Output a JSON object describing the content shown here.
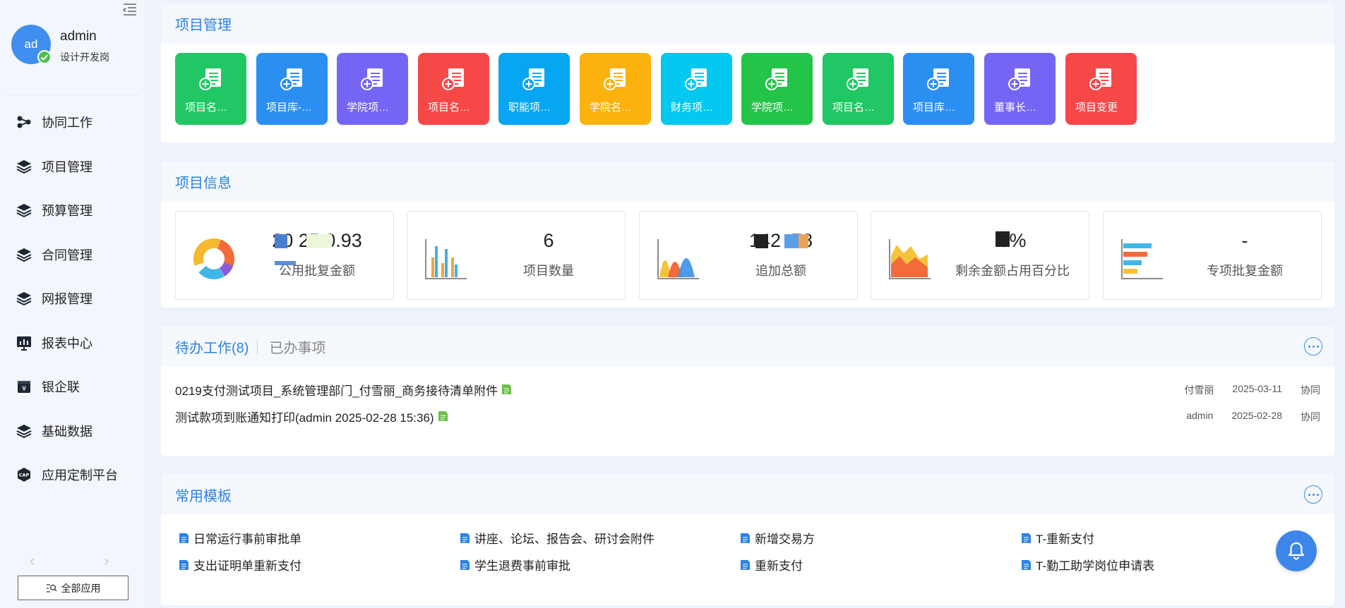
{
  "user": {
    "avatar_text": "ad",
    "name": "admin",
    "role": "设计开发岗"
  },
  "sidebar": {
    "items": [
      {
        "label": "协同工作",
        "icon": "collaboration-icon"
      },
      {
        "label": "项目管理",
        "icon": "layers-icon"
      },
      {
        "label": "预算管理",
        "icon": "layers-icon"
      },
      {
        "label": "合同管理",
        "icon": "layers-icon"
      },
      {
        "label": "网报管理",
        "icon": "layers-icon"
      },
      {
        "label": "报表中心",
        "icon": "report-chart-icon"
      },
      {
        "label": "银企联",
        "icon": "bank-icon"
      },
      {
        "label": "基础数据",
        "icon": "layers-icon"
      },
      {
        "label": "应用定制平台",
        "icon": "cap-icon"
      }
    ],
    "all_apps_label": "全部应用"
  },
  "project_management": {
    "title": "项目管理",
    "tiles": [
      {
        "label": "项目名…",
        "color": "#21c764"
      },
      {
        "label": "项目库-…",
        "color": "#2b8ff2"
      },
      {
        "label": "学院项…",
        "color": "#7565f5"
      },
      {
        "label": "项目名…",
        "color": "#f74848"
      },
      {
        "label": "职能项…",
        "color": "#06a6f2"
      },
      {
        "label": "学院名…",
        "color": "#fbb20e"
      },
      {
        "label": "财务项…",
        "color": "#04c8ef"
      },
      {
        "label": "学院项…",
        "color": "#24c44a"
      },
      {
        "label": "项目名…",
        "color": "#21c764"
      },
      {
        "label": "项目库…",
        "color": "#2b8ff2"
      },
      {
        "label": "董事长…",
        "color": "#7565f5"
      },
      {
        "label": "项目变更",
        "color": "#f74848"
      }
    ]
  },
  "project_info": {
    "title": "项目信息",
    "cards": [
      {
        "value": "20   25    0.93",
        "label": "公用批复金额",
        "chart": "donut-chart-icon"
      },
      {
        "value": "6",
        "label": "项目数量",
        "chart": "bar-chart-icon"
      },
      {
        "value": "142      .78",
        "label": "追加总额",
        "chart": "area-peaks-icon"
      },
      {
        "value": "6%",
        "label": "剩余金额占用百分比",
        "chart": "area-chart-icon"
      },
      {
        "value": "-",
        "label": "专项批复金额",
        "chart": "horizontal-bar-icon"
      }
    ]
  },
  "todo": {
    "tab_active": "待办工作(8)",
    "tab_inactive": "已办事项",
    "rows": [
      {
        "title": "0219支付测试项目_系统管理部门_付雪丽_商务接待清单附件",
        "person": "付雪丽",
        "date": "2025-03-11",
        "type": "协同"
      },
      {
        "title": "测试款项到账通知打印(admin 2025-02-28 15:36)",
        "person": "admin",
        "date": "2025-02-28",
        "type": "协同"
      }
    ]
  },
  "templates": {
    "title": "常用模板",
    "items": [
      "日常运行事前审批单",
      "讲座、论坛、报告会、研讨会附件",
      "新增交易方",
      "T-重新支付",
      "支出证明单重新支付",
      "学生退费事前审批",
      "重新支付",
      "T-勤工助学岗位申请表"
    ]
  }
}
